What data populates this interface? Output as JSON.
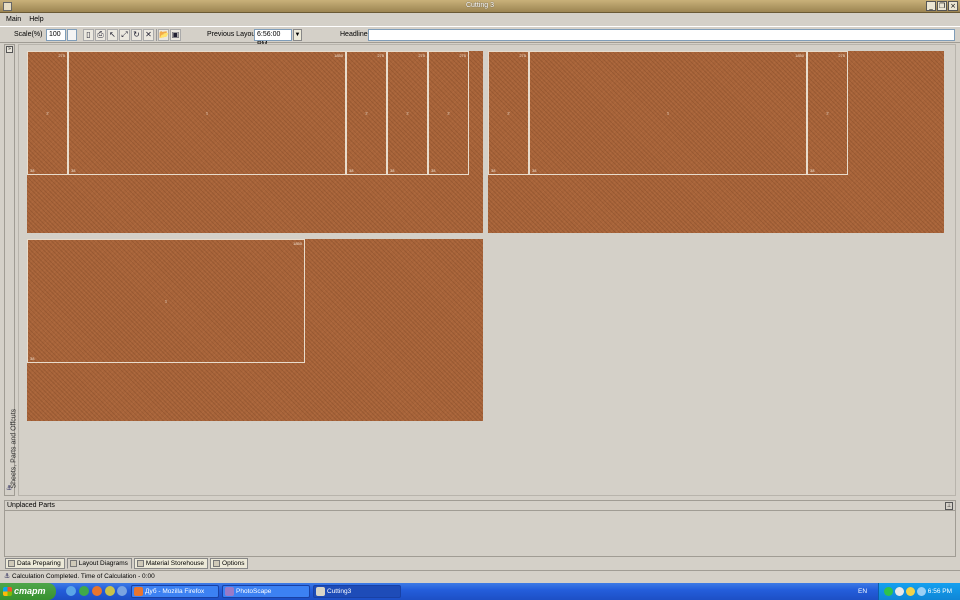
{
  "window": {
    "title": "Cutting 3"
  },
  "menu": [
    "Main",
    "Help"
  ],
  "toolbar": {
    "scale_label": "Scale(%)",
    "scale_value": "100",
    "previous_layout_label": "Previous Layout",
    "previous_layout_value": "6:56:00 PM",
    "headline_label": "Headline",
    "headline_value": "",
    "icons": [
      "document-icon",
      "print-preview-icon",
      "print-icon",
      "cursor-icon",
      "fit-icon",
      "rotate-icon",
      "delete-icon",
      "open-folder-icon",
      "save-icon"
    ]
  },
  "side_panel": {
    "label": "Sheets, Parts and Offcuts"
  },
  "sheets": [
    {
      "parts": [
        {
          "id": "2",
          "w": "275",
          "h": "38"
        },
        {
          "id": "1",
          "w": "1850",
          "h": "38"
        },
        {
          "id": "2",
          "w": "275",
          "h": "38"
        },
        {
          "id": "2",
          "w": "275",
          "h": "38"
        },
        {
          "id": "2",
          "w": "275",
          "h": "38"
        }
      ]
    },
    {
      "parts": [
        {
          "id": "2",
          "w": "275",
          "h": "38"
        },
        {
          "id": "1",
          "w": "1850",
          "h": "38"
        },
        {
          "id": "2",
          "w": "275",
          "h": "38"
        }
      ]
    },
    {
      "parts": [
        {
          "id": "1",
          "w": "1850",
          "h": "38"
        }
      ]
    }
  ],
  "unplaced": {
    "title": "Unplaced Parts"
  },
  "tabs": [
    {
      "label": "Data Preparing",
      "active": false
    },
    {
      "label": "Layout Diagrams",
      "active": true
    },
    {
      "label": "Material Storehouse",
      "active": false
    },
    {
      "label": "Options",
      "active": false
    }
  ],
  "status": {
    "text": "Calculation Completed. Time of Calculation - 0:00"
  },
  "taskbar": {
    "start_label": "старт",
    "tasks": [
      {
        "label": "Дуб - Mozilla Firefox",
        "active": false
      },
      {
        "label": "PhotoScape",
        "active": false
      },
      {
        "label": "Cutting3",
        "active": true
      }
    ],
    "language": "EN",
    "clock": "6:56 PM"
  },
  "colors": {
    "wood": "#a8643a",
    "title_bar": "#b09a64",
    "taskbar": "#245edb",
    "start_button": "#37912f"
  }
}
